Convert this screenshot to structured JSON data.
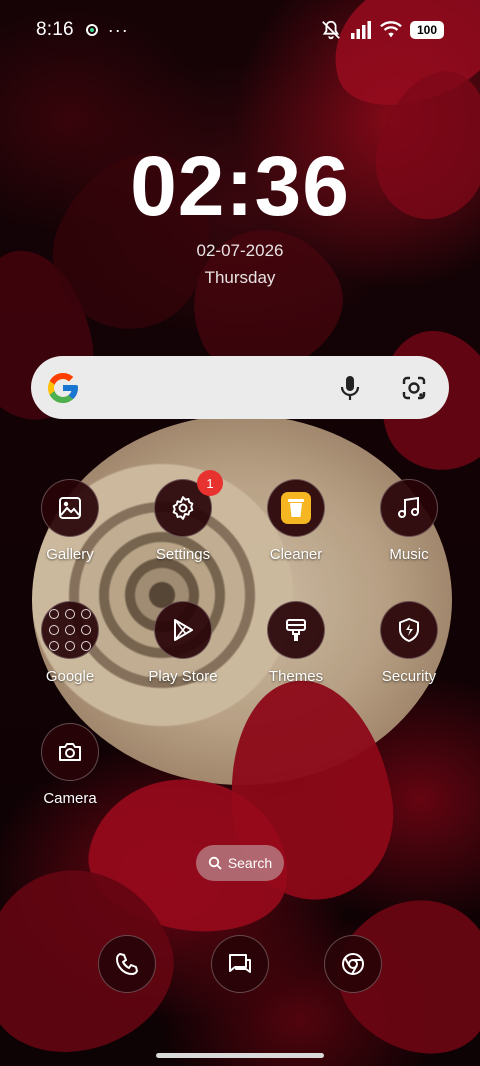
{
  "status_bar": {
    "time": "8:16",
    "battery": "100",
    "icons": [
      "notification-dot-icon",
      "more-icon",
      "mute-icon",
      "signal-icon",
      "wifi-icon",
      "battery-icon"
    ]
  },
  "clock_widget": {
    "time": "02:36",
    "date": "02-07-2026",
    "day": "Thursday"
  },
  "search_bar": {
    "icons": [
      "google-logo-icon",
      "microphone-icon",
      "lens-icon"
    ]
  },
  "apps": [
    {
      "label": "Gallery",
      "icon": "gallery-icon"
    },
    {
      "label": "Settings",
      "icon": "gear-icon",
      "badge": "1"
    },
    {
      "label": "Cleaner",
      "icon": "cleaner-icon"
    },
    {
      "label": "Music",
      "icon": "music-note-icon"
    },
    {
      "label": "Google",
      "icon": "folder-icon"
    },
    {
      "label": "Play Store",
      "icon": "play-store-icon"
    },
    {
      "label": "Themes",
      "icon": "brush-icon"
    },
    {
      "label": "Security",
      "icon": "shield-icon"
    },
    {
      "label": "Camera",
      "icon": "camera-icon"
    }
  ],
  "search_pill": {
    "label": "Search"
  },
  "dock": [
    {
      "icon": "phone-icon"
    },
    {
      "icon": "messages-icon"
    },
    {
      "icon": "chrome-icon"
    }
  ],
  "colors": {
    "badge": "#e8322f",
    "cleaner": "#f6b621",
    "icon_bg": "#28030a"
  }
}
